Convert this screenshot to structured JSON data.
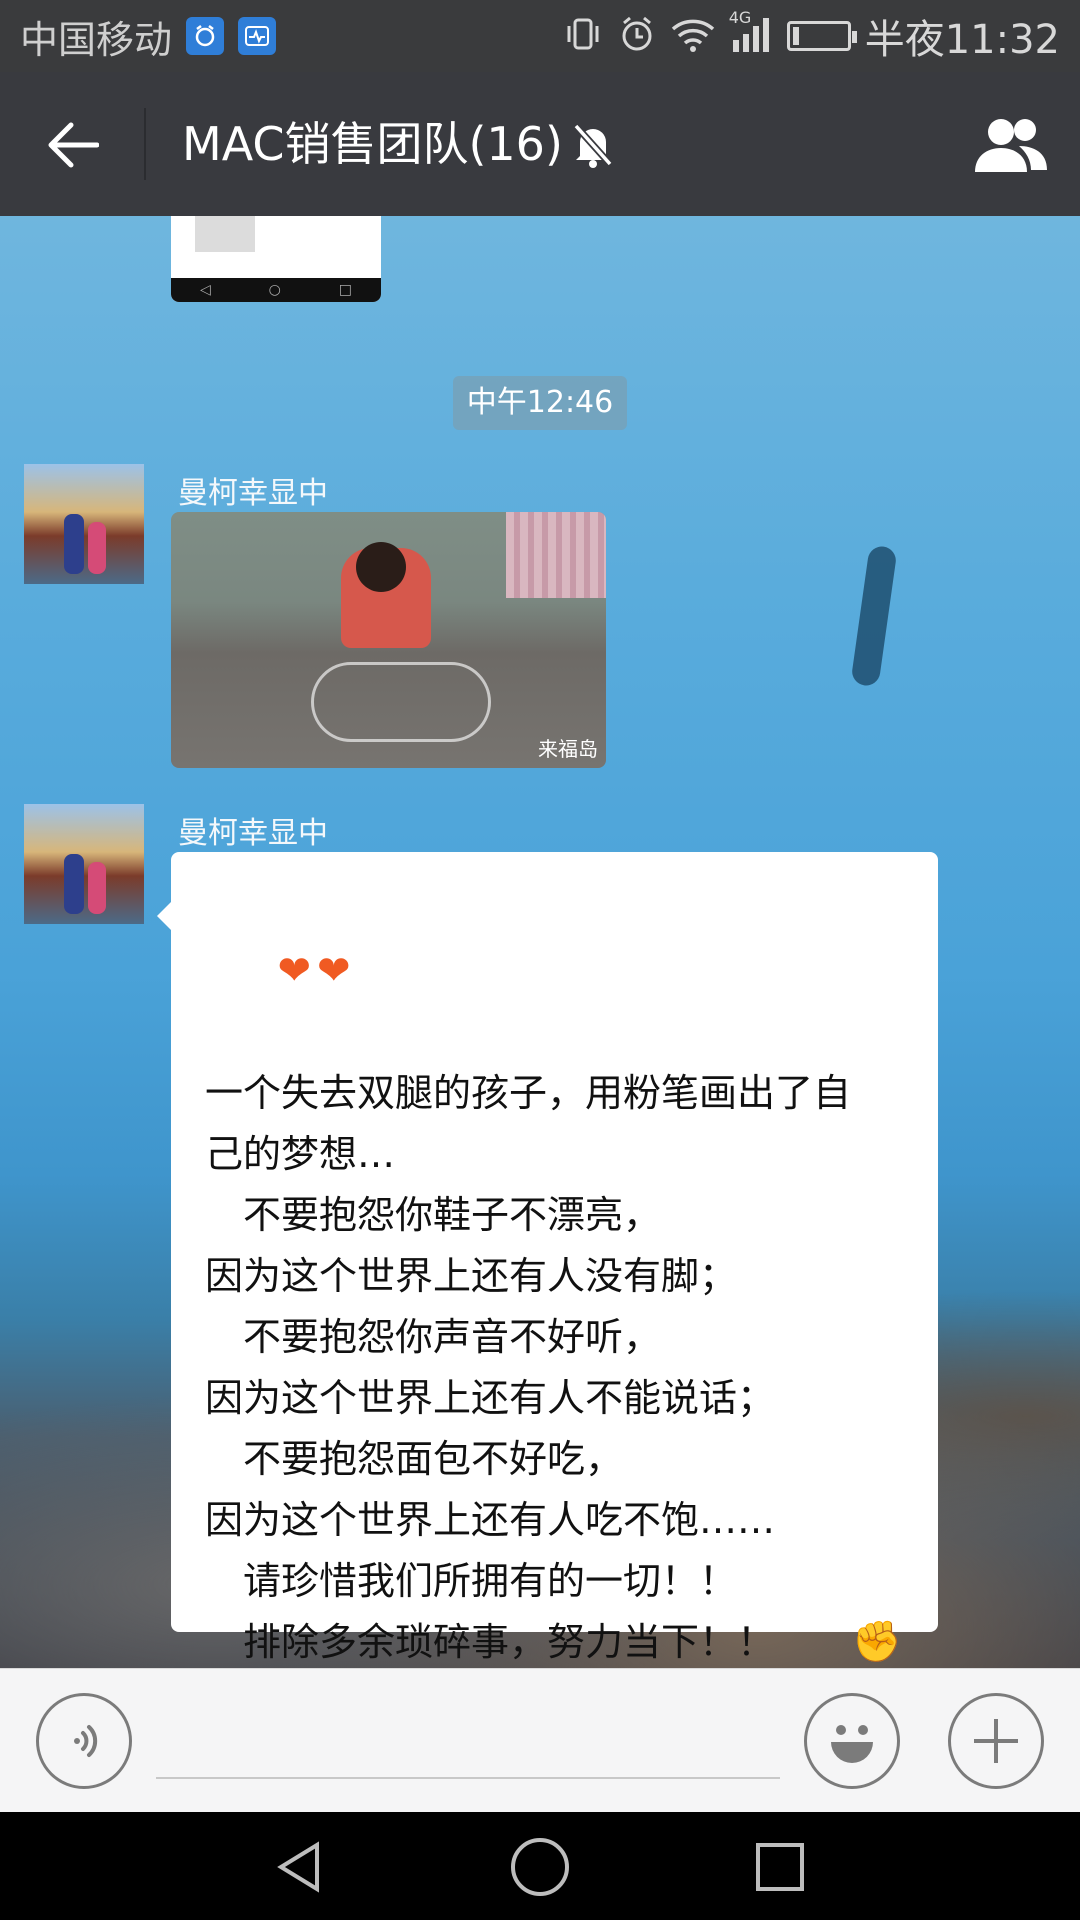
{
  "status_bar": {
    "carrier": "中国移动",
    "network": "4G",
    "time": "半夜11:32",
    "battery_level": 0.12
  },
  "title_bar": {
    "title": "MAC销售团队(16)",
    "muted": true
  },
  "chat": {
    "time_divider": "中午12:46",
    "messages": [
      {
        "sender": "曼柯幸显中",
        "type": "image",
        "watermark": "来福岛"
      },
      {
        "sender": "曼柯幸显中",
        "type": "text",
        "lines": [
          "一个失去双腿的孩子，用粉笔画出了自",
          "己的梦想…",
          "　不要抱怨你鞋子不漂亮，",
          "因为这个世界上还有人没有脚；",
          "　不要抱怨你声音不好听，",
          "因为这个世界上还有人不能说话；",
          "　不要抱怨面包不好吃，",
          "因为这个世界上还有人吃不饱……",
          "　请珍惜我们所拥有的一切！！",
          "　排除多余琐碎事，努力当下！！"
        ]
      }
    ]
  },
  "colors": {
    "title_bar": "#393a3f",
    "status_bar": "#3a3b3d",
    "input_bar": "#f5f5f6"
  }
}
